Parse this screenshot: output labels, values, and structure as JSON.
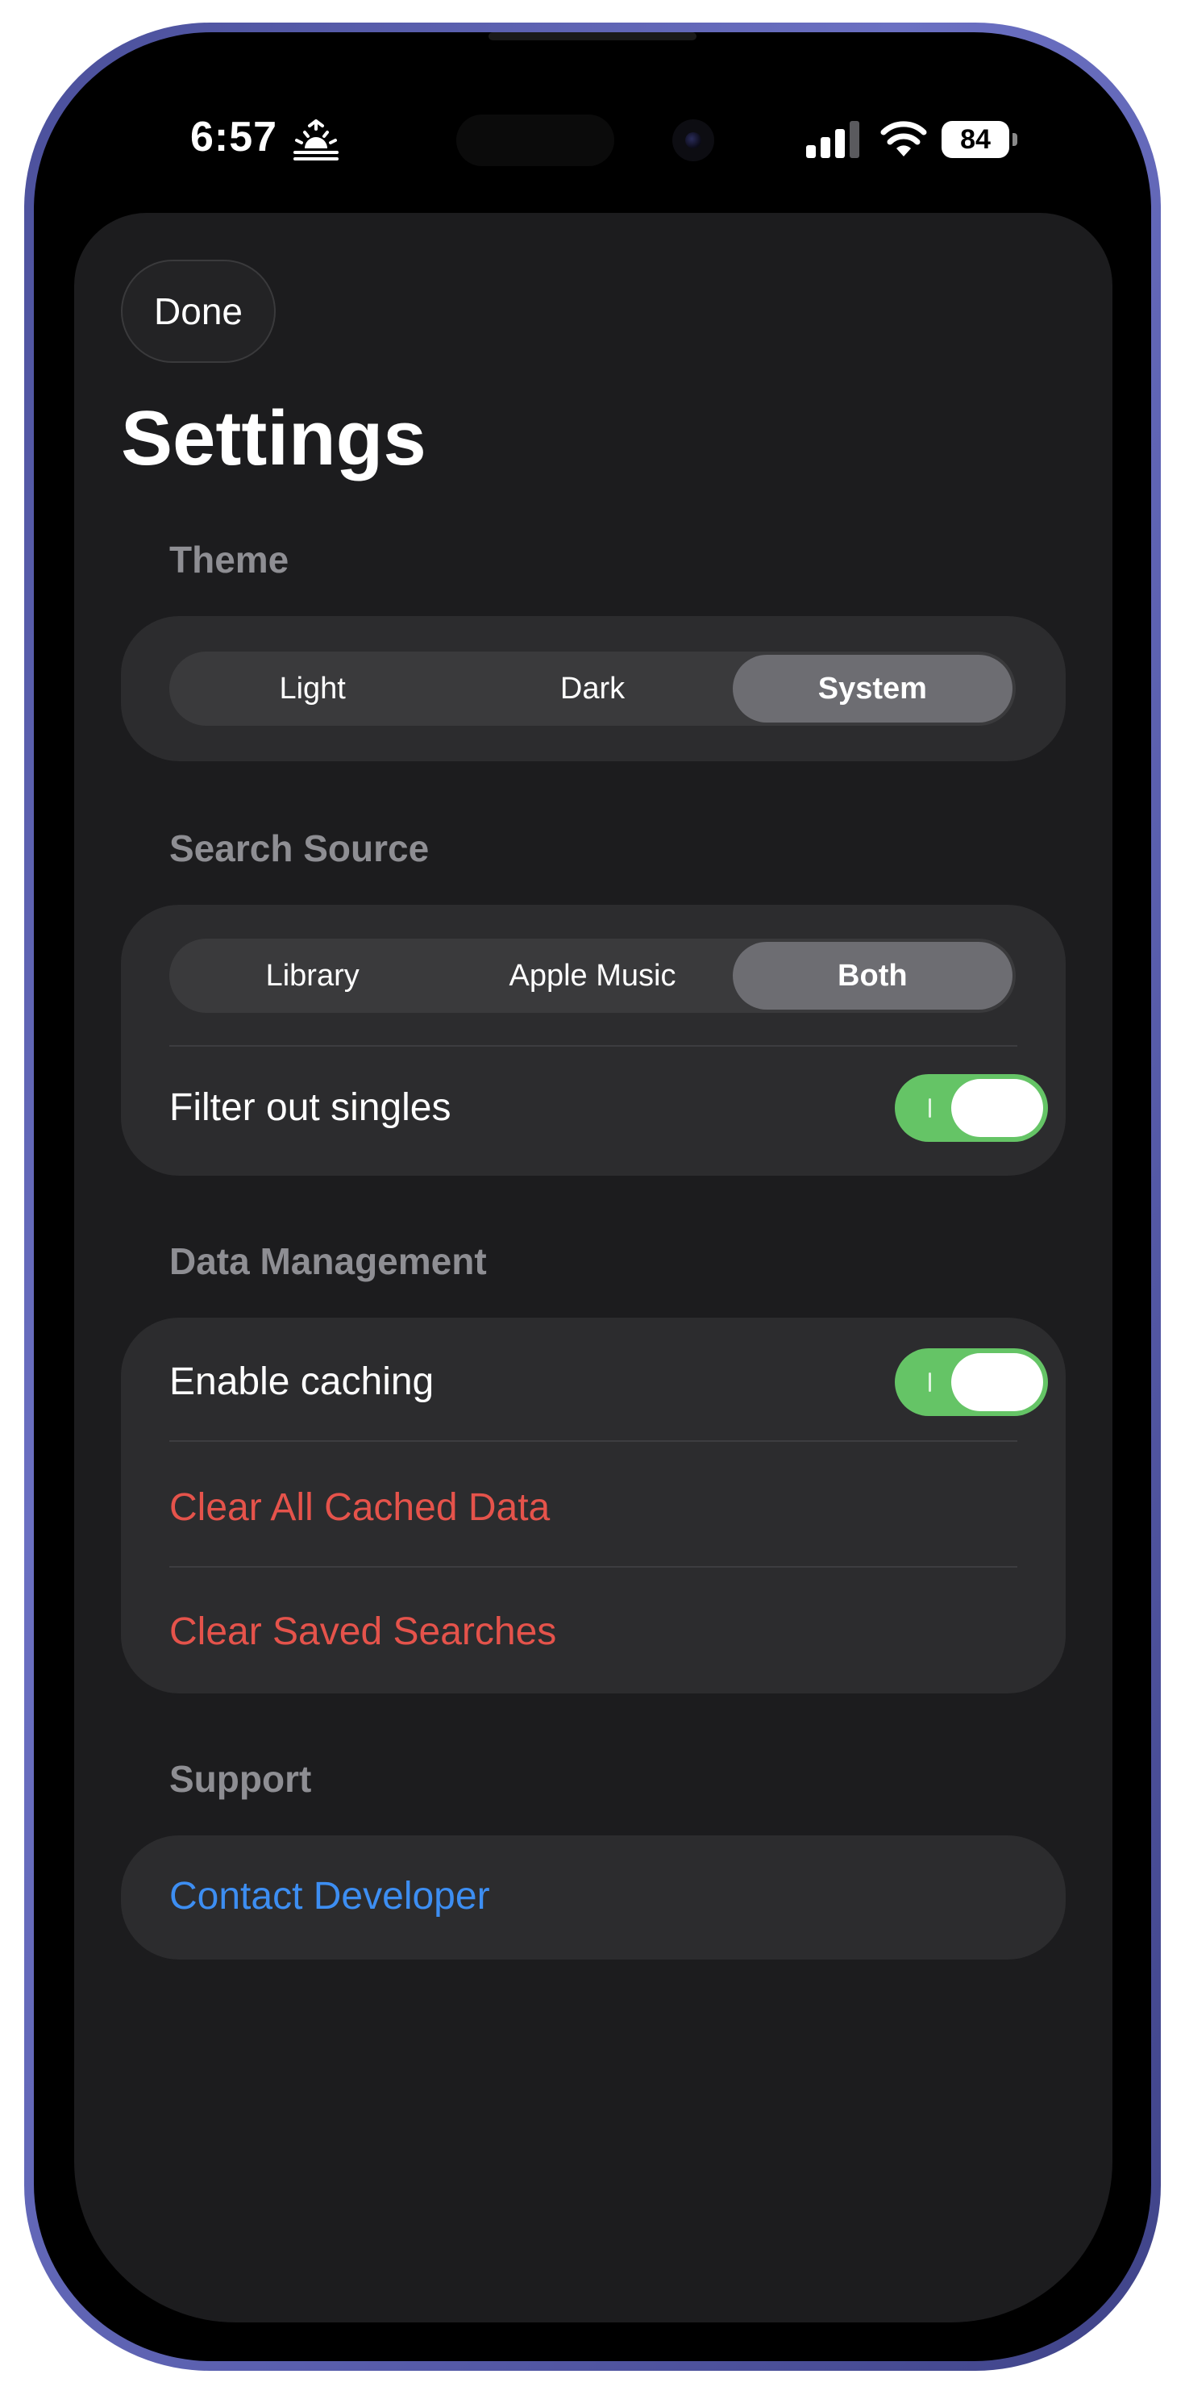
{
  "status_bar": {
    "time": "6:57",
    "battery": "84"
  },
  "sheet": {
    "done_label": "Done",
    "title": "Settings"
  },
  "theme": {
    "header": "Theme",
    "options": [
      "Light",
      "Dark",
      "System"
    ],
    "selected": "System"
  },
  "search_source": {
    "header": "Search Source",
    "options": [
      "Library",
      "Apple Music",
      "Both"
    ],
    "selected": "Both",
    "filter_singles_label": "Filter out singles",
    "filter_singles_on": true
  },
  "data_management": {
    "header": "Data Management",
    "caching_label": "Enable caching",
    "caching_on": true,
    "clear_cache_label": "Clear All Cached Data",
    "clear_searches_label": "Clear Saved Searches"
  },
  "support": {
    "header": "Support",
    "contact_label": "Contact Developer"
  },
  "colors": {
    "toggle_on": "#65c466",
    "destructive": "#e5534b",
    "link": "#3d8ef2",
    "sheet_bg": "#1c1c1e",
    "card_bg": "#2c2c2e",
    "frame": "#5a5fae"
  }
}
